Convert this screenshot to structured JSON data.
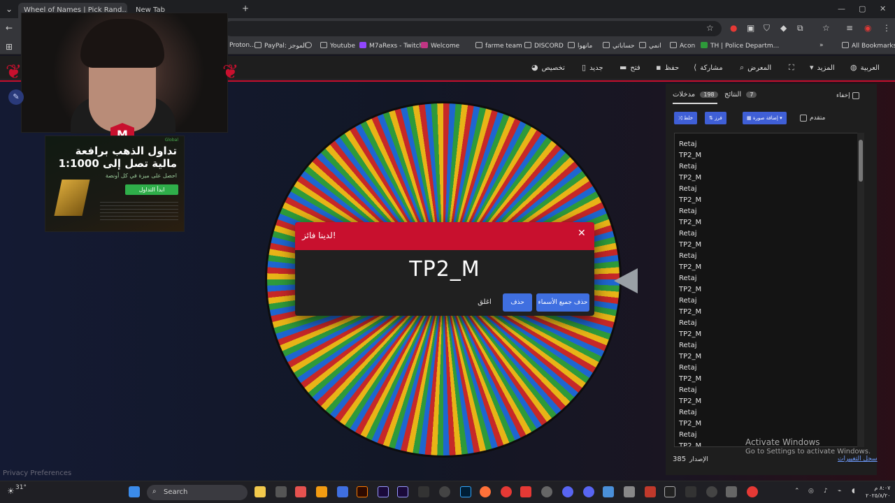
{
  "browser": {
    "tabs": [
      {
        "label": "Wheel of Names | Pick Rand..."
      },
      {
        "label": "New Tab"
      }
    ],
    "bookmarks": [
      {
        "label": "Proton..."
      },
      {
        "label": "PayPal: الموجز"
      },
      {
        "label": "Youtube"
      },
      {
        "label": "M7aRexs - Twitch"
      },
      {
        "label": "Welcome"
      },
      {
        "label": "farme team"
      },
      {
        "label": "DISCORD"
      },
      {
        "label": "مانهوا"
      },
      {
        "label": "حساباتي"
      },
      {
        "label": "انمي"
      },
      {
        "label": "Acon"
      },
      {
        "label": "TH | Police Departm..."
      }
    ],
    "all_bookmarks": "All Bookmarks"
  },
  "header": {
    "menu": [
      {
        "label": "العربية",
        "icon": "globe-icon"
      },
      {
        "label": "المزيد",
        "icon": "chevron-down-icon"
      },
      {
        "label": "",
        "icon": "fullscreen-icon"
      },
      {
        "label": "المعرض",
        "icon": "search-icon"
      },
      {
        "label": "مشاركة",
        "icon": "share-icon"
      },
      {
        "label": "حفظ",
        "icon": "save-icon"
      },
      {
        "label": "فتح",
        "icon": "folder-icon"
      },
      {
        "label": "جديد",
        "icon": "file-icon"
      },
      {
        "label": "تخصيص",
        "icon": "palette-icon"
      }
    ]
  },
  "ad": {
    "brand": "Global",
    "headline": "تداول الذهب برافعة مالية تصل إلى 1:1000",
    "subline": "احصل على ميزة في كل أونصة",
    "cta": "ابدأ التداول"
  },
  "modal": {
    "title": "لدينا فائز!",
    "winner": "TP2_M",
    "remove_all_label": "حذف جميع الأسماء",
    "remove_label": "حذف",
    "close_label": "اغلق"
  },
  "panel": {
    "hide_label": "إخفاء",
    "entries_tab": "مدخلات",
    "entries_count": "198",
    "results_tab": "النتائج",
    "results_count": "7",
    "shuffle_label": "خلط",
    "sort_label": "فرز",
    "add_image_label": "إضافة صورة",
    "advanced_label": "متقدم",
    "entries": [
      "Retaj",
      "TP2_M",
      "Retaj",
      "TP2_M",
      "Retaj",
      "TP2_M",
      "Retaj",
      "TP2_M",
      "Retaj",
      "TP2_M",
      "Retaj",
      "TP2_M",
      "Retaj",
      "TP2_M",
      "Retaj",
      "TP2_M",
      "Retaj",
      "TP2_M",
      "Retaj",
      "TP2_M",
      "Retaj",
      "TP2_M",
      "Retaj",
      "TP2_M",
      "Retaj",
      "TP2_M",
      "Retaj",
      "TP2_M"
    ],
    "version_label": "الإصدار",
    "version_value": "385",
    "changelog_label": "سجل التغييرات"
  },
  "windows_watermark": {
    "line1": "Activate Windows",
    "line2": "Go to Settings to activate Windows."
  },
  "privacy": "Privacy Preferences",
  "taskbar": {
    "weather": "31°",
    "search_placeholder": "Search",
    "clock_time": "٨:٠٧ م",
    "clock_date": "٢٠٢٥/٨/٢٠"
  },
  "colors": {
    "accent_red": "#c8102e",
    "button_blue": "#3f6fe0",
    "wheel": [
      "#c62828",
      "#1e66d0",
      "#2e9a3a",
      "#e8b417"
    ]
  }
}
